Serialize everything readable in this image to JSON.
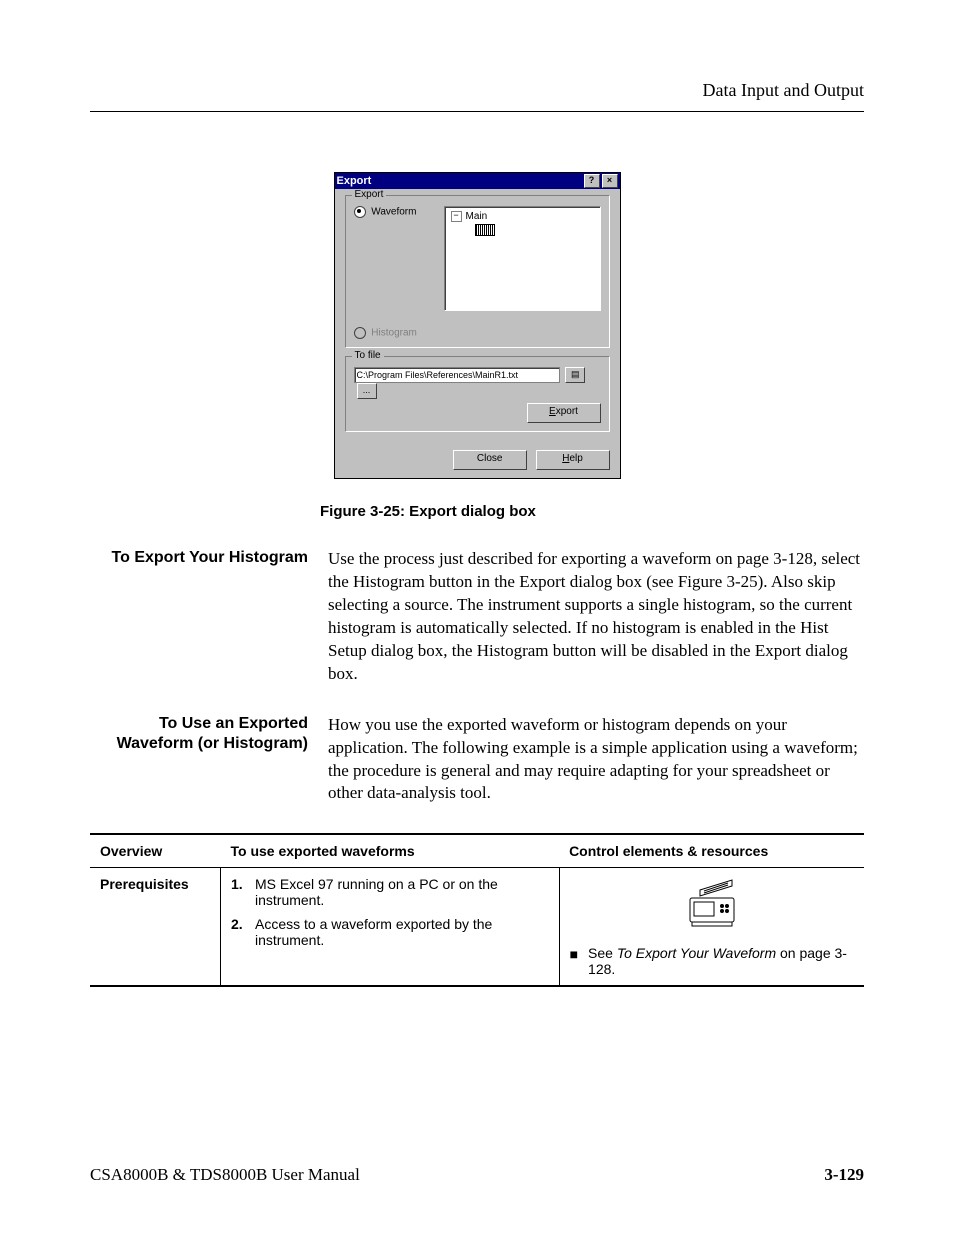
{
  "header": {
    "running_head": "Data Input and Output"
  },
  "dialog": {
    "title": "Export",
    "help_btn": "?",
    "close_btn": "×",
    "group_export": "Export",
    "radio_waveform": "Waveform",
    "radio_histogram": "Histogram",
    "tree_toggle": "−",
    "tree_root": "Main",
    "group_tofile": "To file",
    "filepath": "C:\\Program Files\\References\\MainR1.txt",
    "browse_ellipsis": "...",
    "btn_export": "Export",
    "btn_close": "Close",
    "btn_help": "Help"
  },
  "figure_caption": "Figure 3-25: Export dialog box",
  "sections": {
    "histogram": {
      "heading": "To Export Your Histogram",
      "body": "Use the process just described for exporting a waveform on page 3-128, select the Histogram button in the Export dialog box (see Figure 3-25). Also skip selecting a source. The instrument supports a single histogram, so the current histogram is automatically selected. If no histogram is enabled in the Hist Setup dialog box, the Histogram button will be disabled in the Export dialog box."
    },
    "use_exported": {
      "heading": "To Use an Exported Waveform (or Histogram)",
      "body": "How you use the exported waveform or histogram depends on your application. The following example is a simple application using a waveform; the procedure is general and may require adapting for your spreadsheet or other data-analysis tool."
    }
  },
  "table": {
    "headers": {
      "c1": "Overview",
      "c2": "To use exported waveforms",
      "c3": "Control elements & resources"
    },
    "row1": {
      "label": "Prerequisites",
      "items": [
        "MS Excel 97 running on a PC or on the instrument.",
        "Access to a waveform exported by the instrument."
      ],
      "resource_before": "See ",
      "resource_em": "To Export Your Waveform",
      "resource_after": " on page 3-128."
    }
  },
  "footer": {
    "manual": "CSA8000B & TDS8000B User Manual",
    "page": "3-129"
  }
}
